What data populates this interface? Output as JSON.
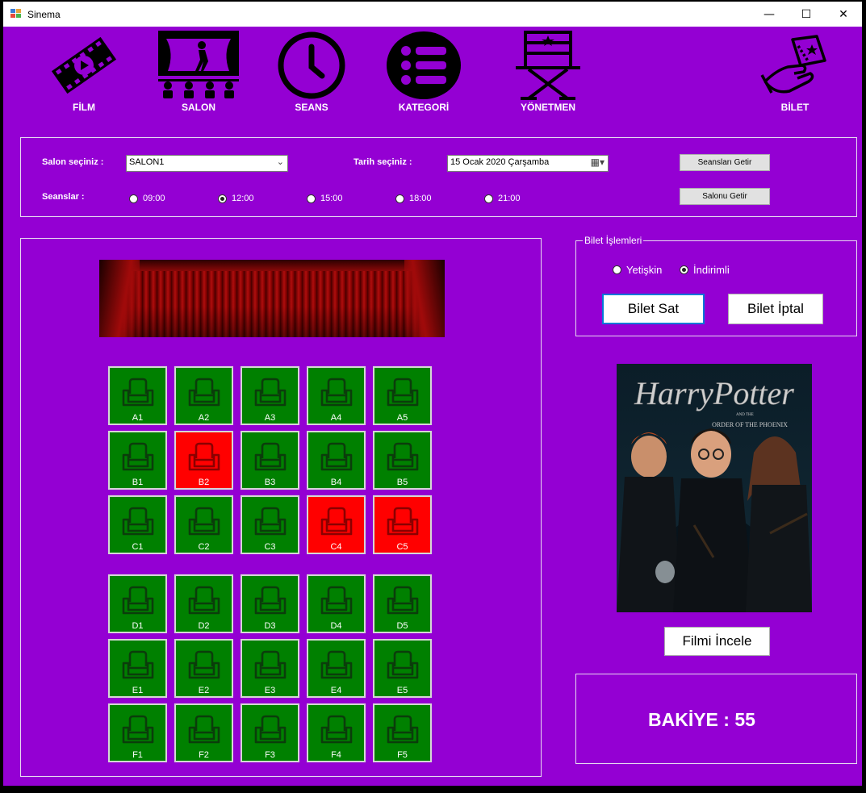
{
  "window": {
    "title": "Sinema",
    "minimize": "—",
    "maximize": "☐",
    "close": "✕"
  },
  "nav": [
    {
      "label": "FİLM",
      "icon": "film-reel-icon"
    },
    {
      "label": "SALON",
      "icon": "stage-audience-icon"
    },
    {
      "label": "SEANS",
      "icon": "clock-icon"
    },
    {
      "label": "KATEGORİ",
      "icon": "list-icon"
    },
    {
      "label": "YÖNETMEN",
      "icon": "director-chair-icon"
    },
    {
      "label": "BİLET",
      "icon": "ticket-hand-icon"
    }
  ],
  "filters": {
    "salon_label": "Salon seçiniz :",
    "salon_value": "SALON1",
    "date_label": "Tarih seçiniz :",
    "date_value": "15   Ocak    2020 Çarşamba",
    "seans_label": "Seanslar :",
    "seans_options": [
      "09:00",
      "12:00",
      "15:00",
      "18:00",
      "21:00"
    ],
    "seans_selected": "12:00",
    "get_sessions_button": "Seansları Getir",
    "get_hall_button": "Salonu Getir"
  },
  "seats": [
    {
      "id": "A1",
      "status": "available"
    },
    {
      "id": "A2",
      "status": "available"
    },
    {
      "id": "A3",
      "status": "available"
    },
    {
      "id": "A4",
      "status": "available"
    },
    {
      "id": "A5",
      "status": "available"
    },
    {
      "id": "B1",
      "status": "available"
    },
    {
      "id": "B2",
      "status": "sold"
    },
    {
      "id": "B3",
      "status": "available"
    },
    {
      "id": "B4",
      "status": "available"
    },
    {
      "id": "B5",
      "status": "available"
    },
    {
      "id": "C1",
      "status": "available"
    },
    {
      "id": "C2",
      "status": "available"
    },
    {
      "id": "C3",
      "status": "available"
    },
    {
      "id": "C4",
      "status": "sold"
    },
    {
      "id": "C5",
      "status": "sold"
    },
    {
      "id": "D1",
      "status": "available"
    },
    {
      "id": "D2",
      "status": "available"
    },
    {
      "id": "D3",
      "status": "available"
    },
    {
      "id": "D4",
      "status": "available"
    },
    {
      "id": "D5",
      "status": "available"
    },
    {
      "id": "E1",
      "status": "available"
    },
    {
      "id": "E2",
      "status": "available"
    },
    {
      "id": "E3",
      "status": "available"
    },
    {
      "id": "E4",
      "status": "available"
    },
    {
      "id": "E5",
      "status": "available"
    },
    {
      "id": "F1",
      "status": "available"
    },
    {
      "id": "F2",
      "status": "available"
    },
    {
      "id": "F3",
      "status": "available"
    },
    {
      "id": "F4",
      "status": "available"
    },
    {
      "id": "F5",
      "status": "available"
    }
  ],
  "ticket": {
    "group_title": "Bilet İşlemleri",
    "type_options": [
      "Yetişkin",
      "İndirimli"
    ],
    "type_selected": "İndirimli",
    "sell_button": "Bilet Sat",
    "cancel_button": "Bilet İptal"
  },
  "movie": {
    "poster_title": "HarryPotter",
    "poster_subtitle_small": "AND THE",
    "poster_subtitle": "ORDER OF THE PHOENIX",
    "inspect_button": "Filmi İncele"
  },
  "balance": {
    "text": "BAKİYE : 55"
  },
  "colors": {
    "background": "#9400d3",
    "seat_available": "#008000",
    "seat_sold": "#ff0000",
    "seat_border": "#d6d6d6"
  }
}
